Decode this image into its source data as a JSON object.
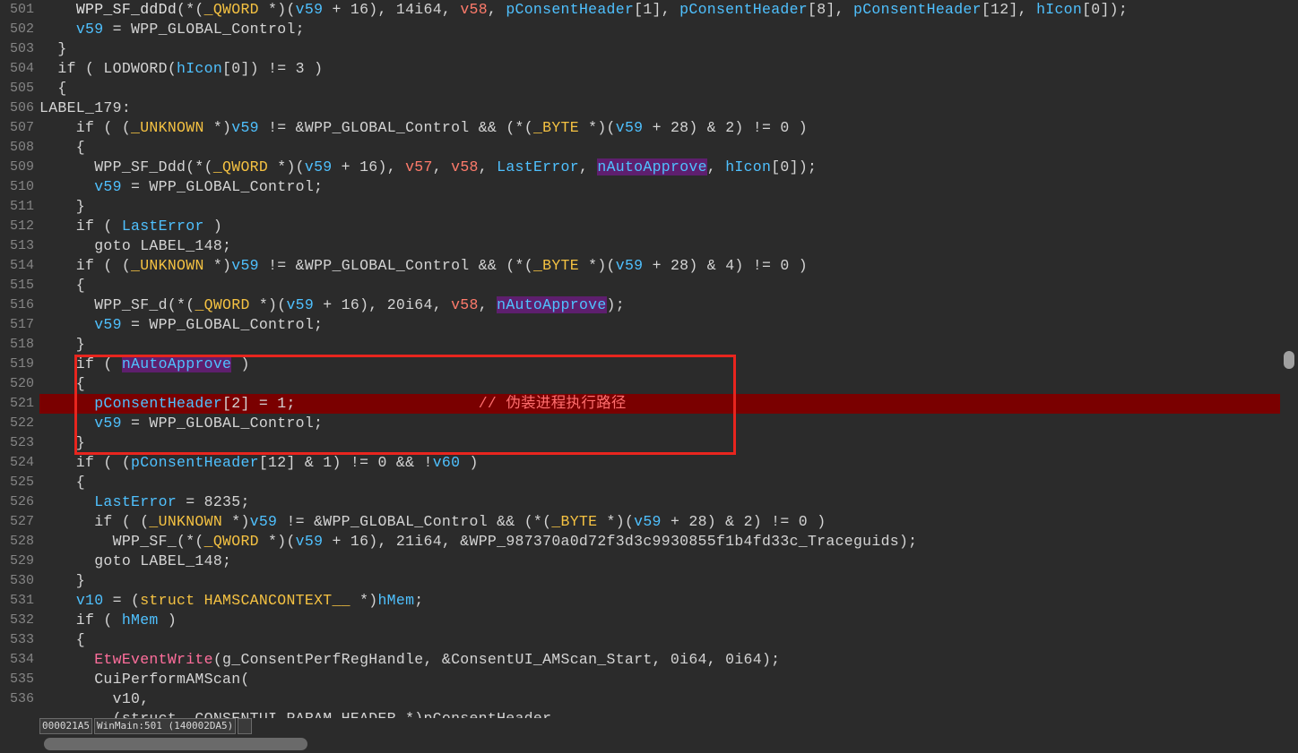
{
  "line_numbers": [
    "501",
    "502",
    "503",
    "504",
    "505",
    "506",
    "507",
    "508",
    "509",
    "510",
    "511",
    "512",
    "513",
    "514",
    "515",
    "516",
    "517",
    "518",
    "519",
    "520",
    "521",
    "522",
    "523",
    "524",
    "525",
    "526",
    "527",
    "528",
    "529",
    "530",
    "531",
    "532",
    "533",
    "534",
    "535",
    "536"
  ],
  "code_lines": [
    [
      [
        "    ",
        "t-kw"
      ],
      [
        "WPP_SF_ddDd",
        "t-fn"
      ],
      [
        "(*(",
        "t-kw"
      ],
      [
        "_QWORD",
        "t-type"
      ],
      [
        " *)(",
        "t-kw"
      ],
      [
        "v59",
        "t-var"
      ],
      [
        " + 16), 14i64, ",
        "t-kw"
      ],
      [
        "v58",
        "t-red"
      ],
      [
        ", ",
        "t-kw"
      ],
      [
        "pConsentHeader",
        "t-var"
      ],
      [
        "[1], ",
        "t-kw"
      ],
      [
        "pConsentHeader",
        "t-var"
      ],
      [
        "[8], ",
        "t-kw"
      ],
      [
        "pConsentHeader",
        "t-var"
      ],
      [
        "[12], ",
        "t-kw"
      ],
      [
        "hIcon",
        "t-var"
      ],
      [
        "[0]);",
        "t-kw"
      ]
    ],
    [
      [
        "    ",
        "t-kw"
      ],
      [
        "v59",
        "t-var"
      ],
      [
        " = WPP_GLOBAL_Control;",
        "t-kw"
      ]
    ],
    [
      [
        "  }",
        "t-kw"
      ]
    ],
    [
      [
        "  if ( LODWORD(",
        "t-kw"
      ],
      [
        "hIcon",
        "t-var"
      ],
      [
        "[0]) != 3 )",
        "t-kw"
      ]
    ],
    [
      [
        "  {",
        "t-kw"
      ]
    ],
    [
      [
        "LABEL_179:",
        "t-kw"
      ]
    ],
    [
      [
        "    if ( (",
        "t-kw"
      ],
      [
        "_UNKNOWN",
        "t-type"
      ],
      [
        " *)",
        "t-kw"
      ],
      [
        "v59",
        "t-var"
      ],
      [
        " != &WPP_GLOBAL_Control && (*(",
        "t-kw"
      ],
      [
        "_BYTE",
        "t-type"
      ],
      [
        " *)(",
        "t-kw"
      ],
      [
        "v59",
        "t-var"
      ],
      [
        " + 28) & 2) != 0 )",
        "t-kw"
      ]
    ],
    [
      [
        "    {",
        "t-kw"
      ]
    ],
    [
      [
        "      WPP_SF_Ddd(*(",
        "t-kw"
      ],
      [
        "_QWORD",
        "t-type"
      ],
      [
        " *)(",
        "t-kw"
      ],
      [
        "v59",
        "t-var"
      ],
      [
        " + 16), ",
        "t-kw"
      ],
      [
        "v57",
        "t-red"
      ],
      [
        ", ",
        "t-kw"
      ],
      [
        "v58",
        "t-red"
      ],
      [
        ", ",
        "t-kw"
      ],
      [
        "LastError",
        "t-var"
      ],
      [
        ", ",
        "t-kw"
      ],
      [
        "nAutoApprove",
        "t-sel"
      ],
      [
        ", ",
        "t-kw"
      ],
      [
        "hIcon",
        "t-var"
      ],
      [
        "[0]);",
        "t-kw"
      ]
    ],
    [
      [
        "      ",
        "t-kw"
      ],
      [
        "v59",
        "t-var"
      ],
      [
        " = WPP_GLOBAL_Control;",
        "t-kw"
      ]
    ],
    [
      [
        "    }",
        "t-kw"
      ]
    ],
    [
      [
        "    if ( ",
        "t-kw"
      ],
      [
        "LastError",
        "t-var"
      ],
      [
        " )",
        "t-kw"
      ]
    ],
    [
      [
        "      goto LABEL_148;",
        "t-kw"
      ]
    ],
    [
      [
        "    if ( (",
        "t-kw"
      ],
      [
        "_UNKNOWN",
        "t-type"
      ],
      [
        " *)",
        "t-kw"
      ],
      [
        "v59",
        "t-var"
      ],
      [
        " != &WPP_GLOBAL_Control && (*(",
        "t-kw"
      ],
      [
        "_BYTE",
        "t-type"
      ],
      [
        " *)(",
        "t-kw"
      ],
      [
        "v59",
        "t-var"
      ],
      [
        " + 28) & 4) != 0 )",
        "t-kw"
      ]
    ],
    [
      [
        "    {",
        "t-kw"
      ]
    ],
    [
      [
        "      WPP_SF_d(*(",
        "t-kw"
      ],
      [
        "_QWORD",
        "t-type"
      ],
      [
        " *)(",
        "t-kw"
      ],
      [
        "v59",
        "t-var"
      ],
      [
        " + 16), 20i64, ",
        "t-kw"
      ],
      [
        "v58",
        "t-red"
      ],
      [
        ", ",
        "t-kw"
      ],
      [
        "nAutoApprove",
        "t-sel"
      ],
      [
        ");",
        "t-kw"
      ]
    ],
    [
      [
        "      ",
        "t-kw"
      ],
      [
        "v59",
        "t-var"
      ],
      [
        " = WPP_GLOBAL_Control;",
        "t-kw"
      ]
    ],
    [
      [
        "    }",
        "t-kw"
      ]
    ],
    [
      [
        "    if ( ",
        "t-kw"
      ],
      [
        "nAutoApprove",
        "t-sel"
      ],
      [
        " )",
        "t-kw"
      ]
    ],
    [
      [
        "    {",
        "t-kw"
      ]
    ],
    [
      [
        "      ",
        "t-kw"
      ],
      [
        "pConsentHeader",
        "t-var"
      ],
      [
        "[2] = 1;",
        "t-kw"
      ],
      [
        "                    ",
        "t-kw"
      ],
      [
        "// 伪装进程执行路径",
        "t-cmt"
      ]
    ],
    [
      [
        "      ",
        "t-kw"
      ],
      [
        "v59",
        "t-var"
      ],
      [
        " = WPP_GLOBAL_Control;",
        "t-kw"
      ]
    ],
    [
      [
        "    }",
        "t-kw"
      ]
    ],
    [
      [
        "    if ( (",
        "t-kw"
      ],
      [
        "pConsentHeader",
        "t-var"
      ],
      [
        "[12] & 1) != 0 && !",
        "t-kw"
      ],
      [
        "v60",
        "t-var"
      ],
      [
        " )",
        "t-kw"
      ]
    ],
    [
      [
        "    {",
        "t-kw"
      ]
    ],
    [
      [
        "      ",
        "t-kw"
      ],
      [
        "LastError",
        "t-var"
      ],
      [
        " = 8235;",
        "t-kw"
      ]
    ],
    [
      [
        "      if ( (",
        "t-kw"
      ],
      [
        "_UNKNOWN",
        "t-type"
      ],
      [
        " *)",
        "t-kw"
      ],
      [
        "v59",
        "t-var"
      ],
      [
        " != &WPP_GLOBAL_Control && (*(",
        "t-kw"
      ],
      [
        "_BYTE",
        "t-type"
      ],
      [
        " *)(",
        "t-kw"
      ],
      [
        "v59",
        "t-var"
      ],
      [
        " + 28) & 2) != 0 )",
        "t-kw"
      ]
    ],
    [
      [
        "        WPP_SF_(*(",
        "t-kw"
      ],
      [
        "_QWORD",
        "t-type"
      ],
      [
        " *)(",
        "t-kw"
      ],
      [
        "v59",
        "t-var"
      ],
      [
        " + 16), 21i64, &WPP_987370a0d72f3d3c9930855f1b4fd33c_Traceguids);",
        "t-kw"
      ]
    ],
    [
      [
        "      goto LABEL_148;",
        "t-kw"
      ]
    ],
    [
      [
        "    }",
        "t-kw"
      ]
    ],
    [
      [
        "    ",
        "t-kw"
      ],
      [
        "v10",
        "t-var"
      ],
      [
        " = (",
        "t-kw"
      ],
      [
        "struct HAMSCANCONTEXT__",
        "t-type"
      ],
      [
        " *)",
        "t-kw"
      ],
      [
        "hMem",
        "t-var"
      ],
      [
        ";",
        "t-kw"
      ]
    ],
    [
      [
        "    if ( ",
        "t-kw"
      ],
      [
        "hMem",
        "t-var"
      ],
      [
        " )",
        "t-kw"
      ]
    ],
    [
      [
        "    {",
        "t-kw"
      ]
    ],
    [
      [
        "      ",
        "t-kw"
      ],
      [
        "EtwEventWrite",
        "t-call"
      ],
      [
        "(g_ConsentPerfRegHandle, &ConsentUI_AMScan_Start, 0i64, 0i64);",
        "t-kw"
      ]
    ],
    [
      [
        "      CuiPerformAMScan(",
        "t-kw"
      ]
    ],
    [
      [
        "        v10,",
        "t-kw"
      ]
    ],
    [
      [
        "        (struct _CONSENTUI_PARAM_HEADER *)pConsentHeader",
        "t-kw"
      ]
    ]
  ],
  "status_bar": {
    "offset": "000021A5",
    "location": "WinMain:501 (140002DA5)"
  },
  "colors": {
    "background": "#2b2b2b",
    "highlight_line": "#7a0000",
    "annotation_box": "#e8251e"
  }
}
